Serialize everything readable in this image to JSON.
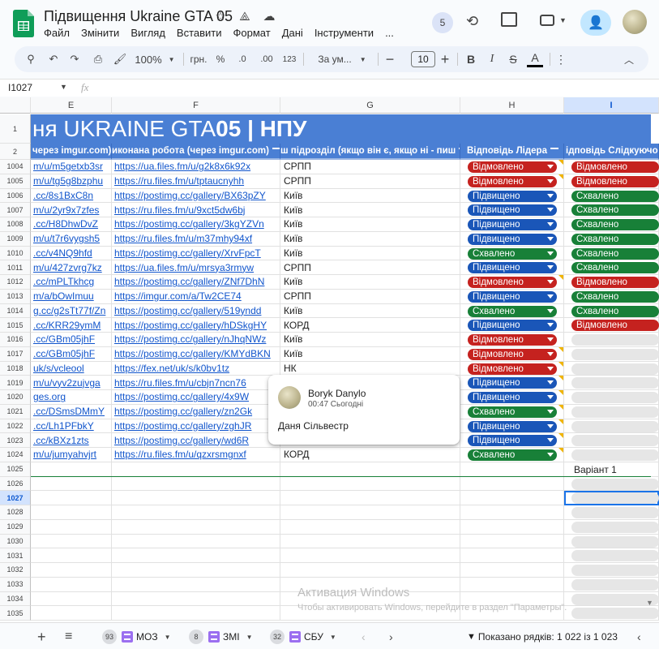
{
  "app": {
    "doc_title": "Підвищення Ukraine GTA 05",
    "menu": [
      "Файл",
      "Змінити",
      "Вигляд",
      "Вставити",
      "Формат",
      "Дані",
      "Інструменти",
      "..."
    ],
    "collaborators_count": "5"
  },
  "toolbar": {
    "zoom": "100%",
    "currency": "грн.",
    "percent": "%",
    "dec_decrease": ".0",
    "dec_increase": ".00",
    "number_format": "123",
    "font": "За ум...",
    "font_size": "10"
  },
  "formula_bar": {
    "name_box": "I1027",
    "fx_label": "fx",
    "value": ""
  },
  "columns": [
    "E",
    "F",
    "G",
    "H",
    "I"
  ],
  "banner": {
    "text_plain": "ня UKRAINE GTA ",
    "text_bold": "05 | НПУ"
  },
  "header_row": {
    "row_num": "2",
    "e": "через imgur.com)",
    "f": "иконана робота (через imgur.com)",
    "g": "ш підрозділ (якщо він є, якщо ні - пиш",
    "h": "Відповідь Лідера",
    "i": "ідповідь Слідкуючо"
  },
  "rows": [
    {
      "n": "1004",
      "e": "m/u/m5getxb3sr",
      "f": "https://ua.files.fm/u/g2k8x6k92x",
      "g": "СРПП",
      "h": "Відмовлено",
      "i": "Відмовлено",
      "hc": "red",
      "ic": "red",
      "note": true
    },
    {
      "n": "1005",
      "e": "m/u/tg5g8bzphu",
      "f": "https://ru.files.fm/u/tptaucnyhh",
      "g": "СРПП",
      "h": "Відмовлено",
      "i": "Відмовлено",
      "hc": "red",
      "ic": "red",
      "note": true
    },
    {
      "n": "1006",
      "e": ".cc/8s1BxC8n",
      "f": "https://postimg.cc/gallery/BX63pZY",
      "g": "Київ",
      "h": "Підвищено",
      "i": "Схвалено",
      "hc": "blue",
      "ic": "green",
      "note": false
    },
    {
      "n": "1007",
      "e": "m/u/2yr9x7zfes",
      "f": "https://ru.files.fm/u/9xct5dw6bj",
      "g": "Київ",
      "h": "Підвищено",
      "i": "Схвалено",
      "hc": "blue",
      "ic": "green",
      "note": false
    },
    {
      "n": "1008",
      "e": ".cc/H8DhwDvZ",
      "f": "https://postimg.cc/gallery/3kgYZVn",
      "g": "Київ",
      "h": "Підвищено",
      "i": "Схвалено",
      "hc": "blue",
      "ic": "green",
      "note": false
    },
    {
      "n": "1009",
      "e": "m/u/t7r6vygsh5",
      "f": "https://ru.files.fm/u/m37mhy94xf",
      "g": "Київ",
      "h": "Підвищено",
      "i": "Схвалено",
      "hc": "blue",
      "ic": "green",
      "note": false
    },
    {
      "n": "1010",
      "e": ".cc/v4NQ9hfd",
      "f": "https://postimg.cc/gallery/XrvFpcT",
      "g": "Київ",
      "h": "Схвалено",
      "i": "Схвалено",
      "hc": "green",
      "ic": "green",
      "note": false
    },
    {
      "n": "1011",
      "e": "m/u/427zvrg7kz",
      "f": "https://ua.files.fm/u/mrsya3rmyw",
      "g": "СРПП",
      "h": "Підвищено",
      "i": "Схвалено",
      "hc": "blue",
      "ic": "green",
      "note": false
    },
    {
      "n": "1012",
      "e": ".cc/mPLTkhcg",
      "f": "https://postimg.cc/gallery/ZNf7DhN",
      "g": "Київ",
      "h": "Відмовлено",
      "i": "Відмовлено",
      "hc": "red",
      "ic": "red",
      "note": true
    },
    {
      "n": "1013",
      "e": "m/a/bOwImuu",
      "f": "https://imgur.com/a/Tw2CE74",
      "g": "СРПП",
      "h": "Підвищено",
      "i": "Схвалено",
      "hc": "blue",
      "ic": "green",
      "note": false
    },
    {
      "n": "1014",
      "e": "g.cc/g2sTt77f/Zn",
      "f": "https://postimg.cc/gallery/519yndd",
      "g": "Київ",
      "h": "Схвалено",
      "i": "Схвалено",
      "hc": "green",
      "ic": "green",
      "note": false
    },
    {
      "n": "1015",
      "e": ".cc/KRR29ymM",
      "f": "https://postimg.cc/gallery/hDSkgHY",
      "g": "КОРД",
      "h": "Підвищено",
      "i": "Відмовлено",
      "hc": "blue",
      "ic": "red",
      "note": false
    },
    {
      "n": "1016",
      "e": ".cc/GBm05jhF",
      "f": "https://postimg.cc/gallery/nJhqNWz",
      "g": "Київ",
      "h": "Відмовлено",
      "i": "",
      "hc": "red",
      "ic": "gray",
      "note": false
    },
    {
      "n": "1017",
      "e": ".cc/GBm05jhF",
      "f": "https://postimg.cc/gallery/KMYdBKN",
      "g": "Київ",
      "h": "Відмовлено",
      "i": "",
      "hc": "red",
      "ic": "gray",
      "note": true
    },
    {
      "n": "1018",
      "e": "uk/s/vcleool",
      "f": "https://fex.net/uk/s/k0bv1tz",
      "g": "НК",
      "h": "Відмовлено",
      "i": "",
      "hc": "red",
      "ic": "gray",
      "note": true
    },
    {
      "n": "1019",
      "e": "m/u/vyv2zujvga",
      "f": "https://ru.files.fm/u/cbjn7ncn76",
      "g": "",
      "h": "Підвищено",
      "i": "",
      "hc": "blue",
      "ic": "gray",
      "note": true
    },
    {
      "n": "1020",
      "e": "ges.org",
      "f": "https://postimg.cc/gallery/4x9W",
      "g": "",
      "h": "Підвищено",
      "i": "",
      "hc": "blue",
      "ic": "gray",
      "note": true
    },
    {
      "n": "1021",
      "e": ".cc/DSmsDMmY",
      "f": "https://postimg.cc/gallery/zn2Gk",
      "g": "",
      "h": "Схвалено",
      "i": "",
      "hc": "green",
      "ic": "gray",
      "note": true
    },
    {
      "n": "1022",
      "e": ".cc/Lh1PFbkY",
      "f": "https://postimg.cc/gallery/zghJR",
      "g": "",
      "h": "Підвищено",
      "i": "",
      "hc": "blue",
      "ic": "gray",
      "note": true
    },
    {
      "n": "1023",
      "e": ".cc/kBXz1zts",
      "f": "https://postimg.cc/gallery/wd6R",
      "g": "",
      "h": "Підвищено",
      "i": "",
      "hc": "blue",
      "ic": "gray",
      "note": true
    },
    {
      "n": "1024",
      "e": "m/u/jumyahvjrt",
      "f": "https://ru.files.fm/u/qzxrsmgnxf",
      "g": "КОРД",
      "h": "Схвалено",
      "i": "",
      "hc": "green",
      "ic": "gray",
      "note": true
    }
  ],
  "extra_rows": [
    "1025",
    "1026",
    "1027",
    "1028",
    "1029",
    "1030",
    "1031",
    "1032",
    "1033",
    "1034",
    "1035"
  ],
  "row_1025_i": "Варіант 1",
  "comment": {
    "author": "Boryk Danylo",
    "time": "00:47 Сьогодні",
    "text": "Даня Сільвестр"
  },
  "watermark": {
    "line1": "Активация Windows",
    "line2": "Чтобы активировать Windows, перейдите в раздел \"Параметры\"."
  },
  "sheets": [
    {
      "count": "93",
      "name": "МОЗ"
    },
    {
      "count": "8",
      "name": "ЗМІ"
    },
    {
      "count": "32",
      "name": "СБУ"
    }
  ],
  "status": "Показано рядків: 1 022 із 1 023",
  "colors": {
    "red": "#c5221f",
    "blue": "#1a56b8",
    "green": "#188038",
    "banner": "#4a7fd4"
  }
}
